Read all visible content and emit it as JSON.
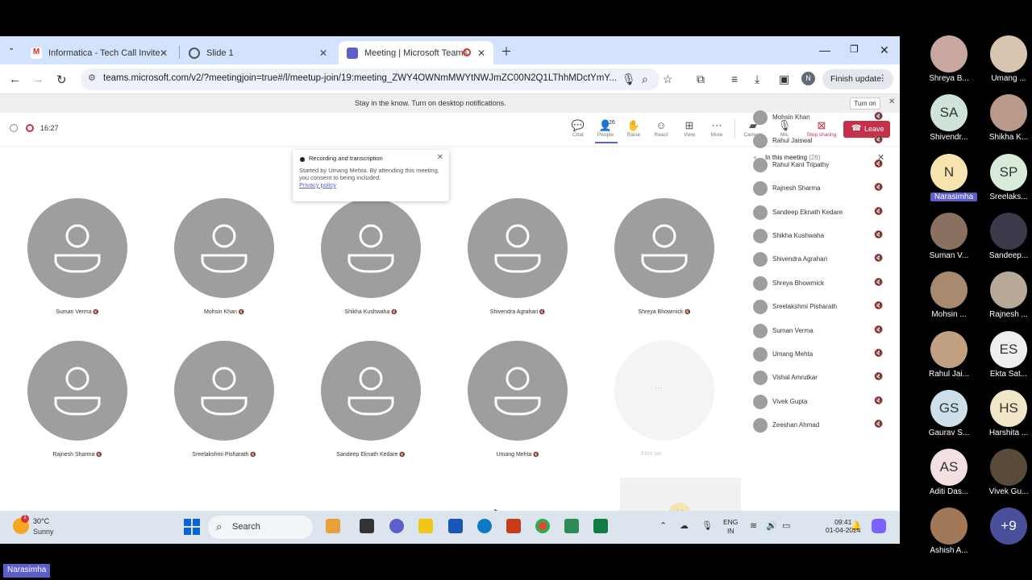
{
  "browser": {
    "tabs": [
      {
        "title": "Informatica - Tech Call Invite -"
      },
      {
        "title": "Slide 1"
      },
      {
        "title": "Meeting | Microsoft Teams"
      }
    ],
    "url": "teams.microsoft.com/v2/?meetingjoin=true#/l/meetup-join/19:meeting_ZWY4OWNmMWYtNWJmZC00N2Q1LThhMDctYmY...",
    "finish_update": "Finish update",
    "profile_initial": "N"
  },
  "notification": {
    "text": "Stay in the know. Turn on desktop notifications.",
    "turn_on": "Turn on"
  },
  "meeting": {
    "timer": "16:27",
    "people_count": "26",
    "toolbar": [
      "Chat",
      "People",
      "Raise",
      "React",
      "View",
      "More",
      "Camera",
      "Mic",
      "Stop sharing"
    ],
    "leave": "Leave"
  },
  "recording_popup": {
    "title": "Recording and transcription",
    "body": "Started by Umang Mehta. By attending this meeting, you consent to being included.",
    "link": "Privacy policy"
  },
  "stage": {
    "participants": [
      "Suman Verma",
      "Mohsin Khan",
      "Shikha Kushwaha",
      "Shivendra Agrahari",
      "Shreya Bhowmick",
      "Rajnesh Sharma",
      "Sreelakshmi Pisharath",
      "Sandeep Eknath Kedare",
      "Umang Mehta"
    ],
    "faded_name": "Ekta sat",
    "self_initial": "N"
  },
  "panel": {
    "title": "In this meeting",
    "count": "(26)",
    "people": [
      "Mohsin Khan",
      "Rahul Jaiswal",
      "Rahul Kant Tripathy",
      "Rajnesh Sharma",
      "Sandeep Eknath Kedare",
      "Shikha Kushwaha",
      "Shivendra Agrahari",
      "Shreya Bhowmick",
      "Sreelakshmi Pisharath",
      "Suman Verma",
      "Umang Mehta",
      "Vishal Amrutkar",
      "Vivek Gupta",
      "Zeeshan Ahmad"
    ]
  },
  "taskbar": {
    "temp": "30°C",
    "condition": "Sunny",
    "weather_badge": "1",
    "search": "Search",
    "lang1": "ENG",
    "lang2": "IN",
    "time": "09:41",
    "date": "01-04-2024"
  },
  "gallery": [
    {
      "name": "Shreya B...",
      "initials": "",
      "color": "#c9a7a0"
    },
    {
      "name": "Umang ...",
      "initials": "",
      "color": "#d9c4b0"
    },
    {
      "name": "Shivendr...",
      "initials": "SA",
      "color": "#cfe3d8"
    },
    {
      "name": "Shikha K...",
      "initials": "",
      "color": "#b99a8a"
    },
    {
      "name": "Narasimha",
      "initials": "N",
      "color": "#f5e3b0"
    },
    {
      "name": "Sreelaks...",
      "initials": "SP",
      "color": "#d8ead8"
    },
    {
      "name": "Suman V...",
      "initials": "",
      "color": "#8a7060"
    },
    {
      "name": "Sandeep...",
      "initials": "",
      "color": "#3a3a4a"
    },
    {
      "name": "Mohsin ...",
      "initials": "",
      "color": "#a88b6f"
    },
    {
      "name": "Rajnesh ...",
      "initials": "",
      "color": "#b8a898"
    },
    {
      "name": "Rahul Jai...",
      "initials": "",
      "color": "#c0a080"
    },
    {
      "name": "Ekta Sat...",
      "initials": "ES",
      "color": "#eeeeee"
    },
    {
      "name": "Gaurav S...",
      "initials": "GS",
      "color": "#cde0ea"
    },
    {
      "name": "Harshita ...",
      "initials": "HS",
      "color": "#f1e6c8"
    },
    {
      "name": "Aditi Das...",
      "initials": "AS",
      "color": "#f3e0e0"
    },
    {
      "name": "Vivek Gu...",
      "initials": "",
      "color": "#5a4a3a"
    },
    {
      "name": "Ashish A...",
      "initials": "",
      "color": "#a07858"
    },
    {
      "name": "",
      "initials": "+9",
      "color": "#4a4f9a"
    }
  ],
  "bottom_label": "Narasimha"
}
